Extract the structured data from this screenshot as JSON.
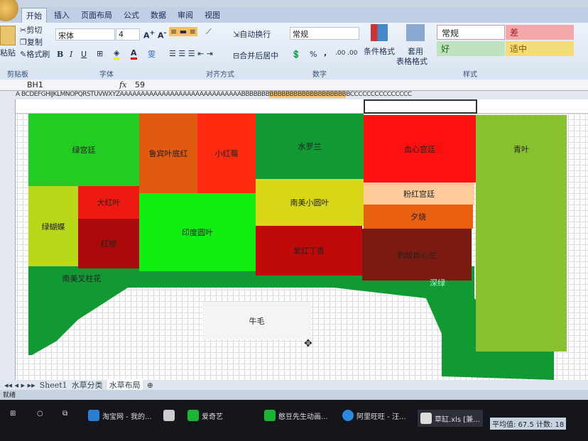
{
  "ribbon": {
    "tabs": [
      "开始",
      "插入",
      "页面布局",
      "公式",
      "数据",
      "审阅",
      "视图"
    ],
    "clipboard": {
      "paste": "粘贴",
      "cut": "剪切",
      "copy": "复制",
      "format_painter": "格式刷",
      "label": "剪贴板"
    },
    "font": {
      "name": "宋体",
      "size": "4",
      "bold": "B",
      "italic": "I",
      "underline": "U",
      "label": "字体"
    },
    "alignment": {
      "wrap": "自动换行",
      "merge": "合并后居中",
      "label": "对齐方式"
    },
    "number": {
      "format": "常规",
      "percent": "%",
      "comma": ",",
      "label": "数字"
    },
    "styles": {
      "conditional": "条件格式",
      "table_format_1": "套用",
      "table_format_2": "表格格式",
      "normal": "常规",
      "bad": "差",
      "good": "好",
      "neutral": "适中",
      "label": "样式"
    }
  },
  "formula_bar": {
    "cell_ref": "BH1",
    "fx": "fx",
    "value": "59"
  },
  "column_headers": {
    "before": "A  BCDEFGHIJKLMNOPQRSTUVWXYZAAAAAAAAAAAAAAAAAAAAAAAAAAAAABBBBBBB",
    "selected": "BBBBBBBBBBBBBBBBBBB",
    "after": "BCCCCCCCCCCCCCCC"
  },
  "blocks": [
    {
      "label": "绿宫廷",
      "color": "#22cc22"
    },
    {
      "label": "鲁宾叶底红",
      "color": "#e05a10"
    },
    {
      "label": "小红莓",
      "color": "#ff2a10"
    },
    {
      "label": "水罗兰",
      "color": "#119933"
    },
    {
      "label": "血心宫廷",
      "color": "#ff1010"
    },
    {
      "label": "青叶",
      "color": "#88c030"
    },
    {
      "label": "绿蝴蝶",
      "color": "#b8d818"
    },
    {
      "label": "大红叶",
      "color": "#ee1a10"
    },
    {
      "label": "红柳",
      "color": "#aa0a0a"
    },
    {
      "label": "印度圆叶",
      "color": "#11ee11"
    },
    {
      "label": "南美小圆叶",
      "color": "#d8d818"
    },
    {
      "label": "粉红宫廷",
      "color": "#ffcc99"
    },
    {
      "label": "夕烧",
      "color": "#e86010"
    },
    {
      "label": "紫红丁香",
      "color": "#c00a0a"
    },
    {
      "label": "豹纹血心兰",
      "color": "#7a1a10"
    },
    {
      "label": "南美叉柱花",
      "color": "#119933"
    },
    {
      "label": "深绿",
      "color": "#119933"
    },
    {
      "label": "牛毛",
      "color": "#f4f4f4"
    }
  ],
  "sheets": [
    "Sheet1",
    "水草分类",
    "水草布局"
  ],
  "status": {
    "ready": "就绪",
    "summary": "平均值: 67.5  计数: 18"
  },
  "taskbar": {
    "items": [
      "淘宝网 - 我的...",
      "爱奇艺",
      "憨豆先生动画...",
      "阿里旺旺 - 汪...",
      "草缸.xls [兼..."
    ]
  }
}
